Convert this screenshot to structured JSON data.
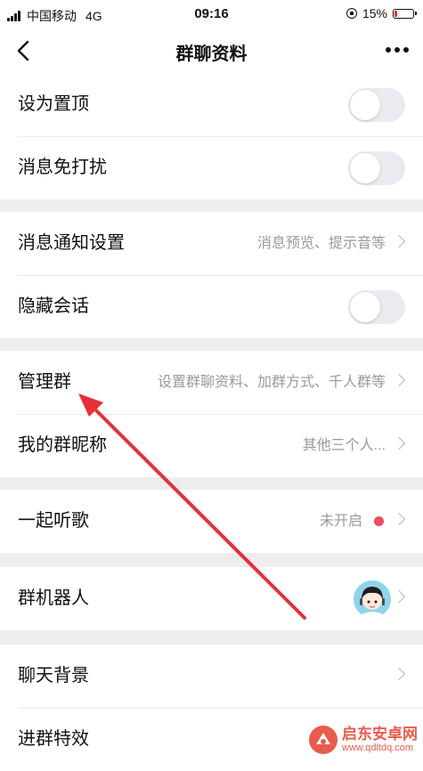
{
  "status_bar": {
    "carrier": "中国移动",
    "network": "4G",
    "time": "09:16",
    "battery": "15%",
    "battery_level": 0.15
  },
  "nav": {
    "title": "群聊资料",
    "back_icon": "chevron-left-icon",
    "more_icon": "more-dots-icon"
  },
  "settings": {
    "pin_label": "设为置顶",
    "pin_on": false,
    "mute_label": "消息免打扰",
    "mute_on": false,
    "notify_label": "消息通知设置",
    "notify_value": "消息预览、提示音等",
    "hide_label": "隐藏会话",
    "hide_on": false,
    "manage_label": "管理群",
    "manage_value": "设置群聊资料、加群方式、千人群等",
    "nickname_label": "我的群昵称",
    "nickname_value": "其他三个人...",
    "listen_label": "一起听歌",
    "listen_value": "未开启",
    "robot_label": "群机器人",
    "background_label": "聊天背景",
    "effect_label": "进群特效"
  },
  "colors": {
    "accent_red": "#e5303a",
    "dot_pink": "#f04b63",
    "page_bg": "#ededed"
  },
  "watermark": {
    "brand": "启东安卓网",
    "url": "www.qdltdq.com"
  }
}
